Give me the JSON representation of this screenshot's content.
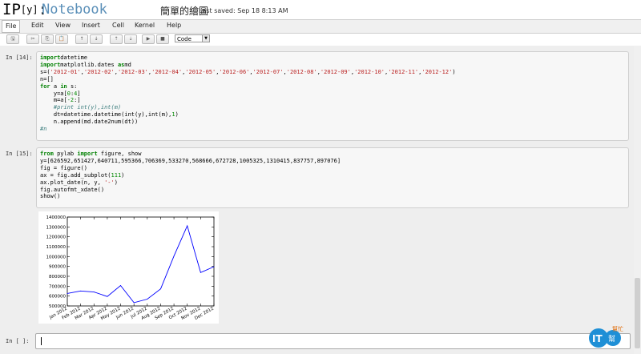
{
  "header": {
    "logo_main": "IP",
    "logo_y": "[y]",
    "logo_colon": ":",
    "notebook_name": "Notebook",
    "title": "簡單的繪圖",
    "last_saved": "Last saved: Sep 18 8:13 AM"
  },
  "menu": [
    "File",
    "Edit",
    "View",
    "Insert",
    "Cell",
    "Kernel",
    "Help"
  ],
  "toolbar": {
    "icons": [
      "save-icon",
      "cut-icon",
      "copy-icon",
      "paste-icon",
      "move-up-icon",
      "move-down-icon",
      "insert-above-icon",
      "insert-below-icon",
      "run-icon",
      "stop-icon"
    ],
    "glyphs": [
      "🖫",
      "✂",
      "⎘",
      "📋",
      "↑",
      "↓",
      "⇡",
      "⇣",
      "▶",
      "■"
    ],
    "cell_type": "Code"
  },
  "cells": [
    {
      "prompt": "In [14]:",
      "lines": [
        [
          [
            "kw",
            "import"
          ],
          [
            "",
            "datetime"
          ]
        ],
        [
          [
            "kw",
            "import"
          ],
          [
            "",
            "matplotlib.dates "
          ],
          [
            "kw",
            "as"
          ],
          [
            "",
            "md"
          ]
        ],
        [
          [
            "",
            "s=("
          ],
          [
            "str",
            "'2012-01'"
          ],
          [
            "",
            ","
          ],
          [
            "str",
            "'2012-02'"
          ],
          [
            "",
            ","
          ],
          [
            "str",
            "'2012-03'"
          ],
          [
            "",
            ","
          ],
          [
            "str",
            "'2012-04'"
          ],
          [
            "",
            ","
          ],
          [
            "str",
            "'2012-05'"
          ],
          [
            "",
            ","
          ],
          [
            "str",
            "'2012-06'"
          ],
          [
            "",
            ","
          ],
          [
            "str",
            "'2012-07'"
          ],
          [
            "",
            ","
          ],
          [
            "str",
            "'2012-08'"
          ],
          [
            "",
            ","
          ],
          [
            "str",
            "'2012-09'"
          ],
          [
            "",
            ","
          ],
          [
            "str",
            "'2012-10'"
          ],
          [
            "",
            ","
          ],
          [
            "str",
            "'2012-11'"
          ],
          [
            "",
            ","
          ],
          [
            "str",
            "'2012-12'"
          ],
          [
            "",
            ")"
          ]
        ],
        [
          [
            "",
            "n=[]"
          ]
        ],
        [
          [
            "kw",
            "for"
          ],
          [
            "",
            " a "
          ],
          [
            "kw",
            "in"
          ],
          [
            "",
            " s:"
          ]
        ],
        [
          [
            "",
            "    y=a["
          ],
          [
            "num",
            "0"
          ],
          [
            "",
            ":"
          ],
          [
            "num",
            "4"
          ],
          [
            "",
            "]"
          ]
        ],
        [
          [
            "",
            "    m=a["
          ],
          [
            "num",
            "-2"
          ],
          [
            "",
            ":]"
          ]
        ],
        [
          [
            "cm",
            "    #print int(y),int(m)"
          ]
        ],
        [
          [
            "",
            "    dt=datetime.datetime(int(y),int(m),"
          ],
          [
            "num",
            "1"
          ],
          [
            "",
            ")"
          ]
        ],
        [
          [
            "",
            "    n.append(md.date2num(dt))"
          ]
        ],
        [
          [
            "cm",
            "#n"
          ]
        ]
      ]
    },
    {
      "prompt": "In [15]:",
      "lines": [
        [
          [
            "kw",
            "from"
          ],
          [
            "",
            " pylab "
          ],
          [
            "kw",
            "import"
          ],
          [
            "",
            " figure, show"
          ]
        ],
        [
          [
            "",
            "y=[626592,651427,640711,595366,706369,533270,568666,672728,1005325,1310415,837757,897076]"
          ]
        ],
        [
          [
            "",
            "fig = figure()"
          ]
        ],
        [
          [
            "",
            "ax = fig.add_subplot("
          ],
          [
            "num",
            "111"
          ],
          [
            "",
            ")"
          ]
        ],
        [
          [
            "",
            "ax.plot_date(n, y, "
          ],
          [
            "str",
            "'-'"
          ],
          [
            "",
            ")"
          ]
        ],
        [
          [
            "",
            "fig.autofmt_xdate()"
          ]
        ],
        [
          [
            "",
            "show()"
          ]
        ]
      ]
    }
  ],
  "empty_prompt": "In [ ]:",
  "watermark": {
    "big": "IT",
    "small": "幫",
    "text": "幫忙"
  },
  "chart_data": {
    "type": "line",
    "x": [
      "Jan 2012",
      "Feb 2012",
      "Mar 2012",
      "Apr 2012",
      "May 2012",
      "Jun 2012",
      "Jul 2012",
      "Aug 2012",
      "Sep 2012",
      "Oct 2012",
      "Nov 2012",
      "Dec 2012"
    ],
    "series": [
      {
        "values": [
          626592,
          651427,
          640711,
          595366,
          706369,
          533270,
          568666,
          672728,
          1005325,
          1310415,
          837757,
          897076
        ]
      }
    ],
    "yticks": [
      500000,
      600000,
      700000,
      800000,
      900000,
      1000000,
      1100000,
      1200000,
      1300000,
      1400000
    ],
    "ylim": [
      500000,
      1400000
    ],
    "grid": false,
    "line_color": "#0000ff"
  }
}
